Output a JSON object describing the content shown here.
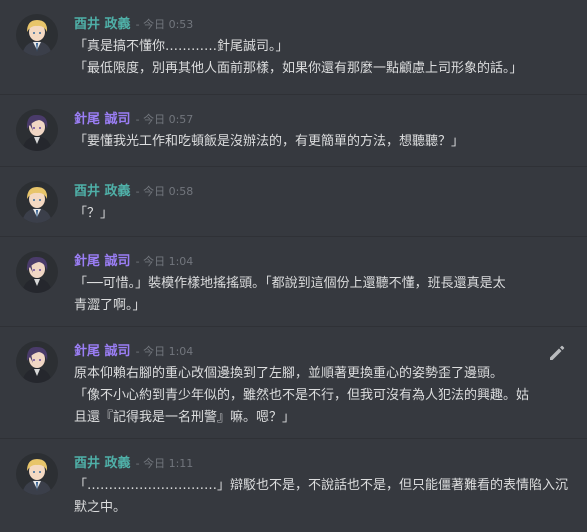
{
  "messages": [
    {
      "author": "酉井 政義",
      "timestamp": "- 今日 0:53",
      "lines": [
        "「真是搞不懂你…………針尾誠司。」",
        "「最低限度，別再其他人面前那樣，如果你還有那麼一點顧慮上司形象的話。」"
      ]
    },
    {
      "author": "針尾 誠司",
      "timestamp": "- 今日 0:57",
      "lines": [
        "「要懂我光工作和吃頓飯是沒辦法的，有更簡單的方法，想聽聽？」"
      ]
    },
    {
      "author": "酉井 政義",
      "timestamp": "- 今日 0:58",
      "lines": [
        "「？」"
      ]
    },
    {
      "author": "針尾 誠司",
      "timestamp": "- 今日 1:04",
      "lines": [
        "「──可惜。」裝模作樣地搖搖頭。「都說到這個份上還聽不懂，班長還真是太",
        "青澀了啊。」"
      ]
    },
    {
      "author": "針尾 誠司",
      "timestamp": "- 今日 1:04",
      "lines": [
        "原本仰賴右腳的重心改個邊換到了左腳，並順著更換重心的姿勢歪了邊頭。",
        "「像不小心約到青少年似的，雖然也不是不行，但我可沒有為人犯法的興趣。姑",
        "且還『記得我是一名刑警』嘛。嗯？」"
      ]
    },
    {
      "author": "酉井 政義",
      "timestamp": "- 今日 1:11",
      "lines": [
        "「…………………………」辯駁也不是，不說話也不是，但只能僵著難看的表情陷入沉",
        "默之中。"
      ]
    }
  ],
  "colors": {
    "background": "#36393f",
    "author_teal": "#4fb0a8",
    "author_purple": "#9b7ef5",
    "text": "#dcddde",
    "timestamp": "#72767d"
  },
  "icons": [
    "blonde-avatar-icon",
    "purple-hair-avatar-icon",
    "edit-pencil-icon"
  ]
}
